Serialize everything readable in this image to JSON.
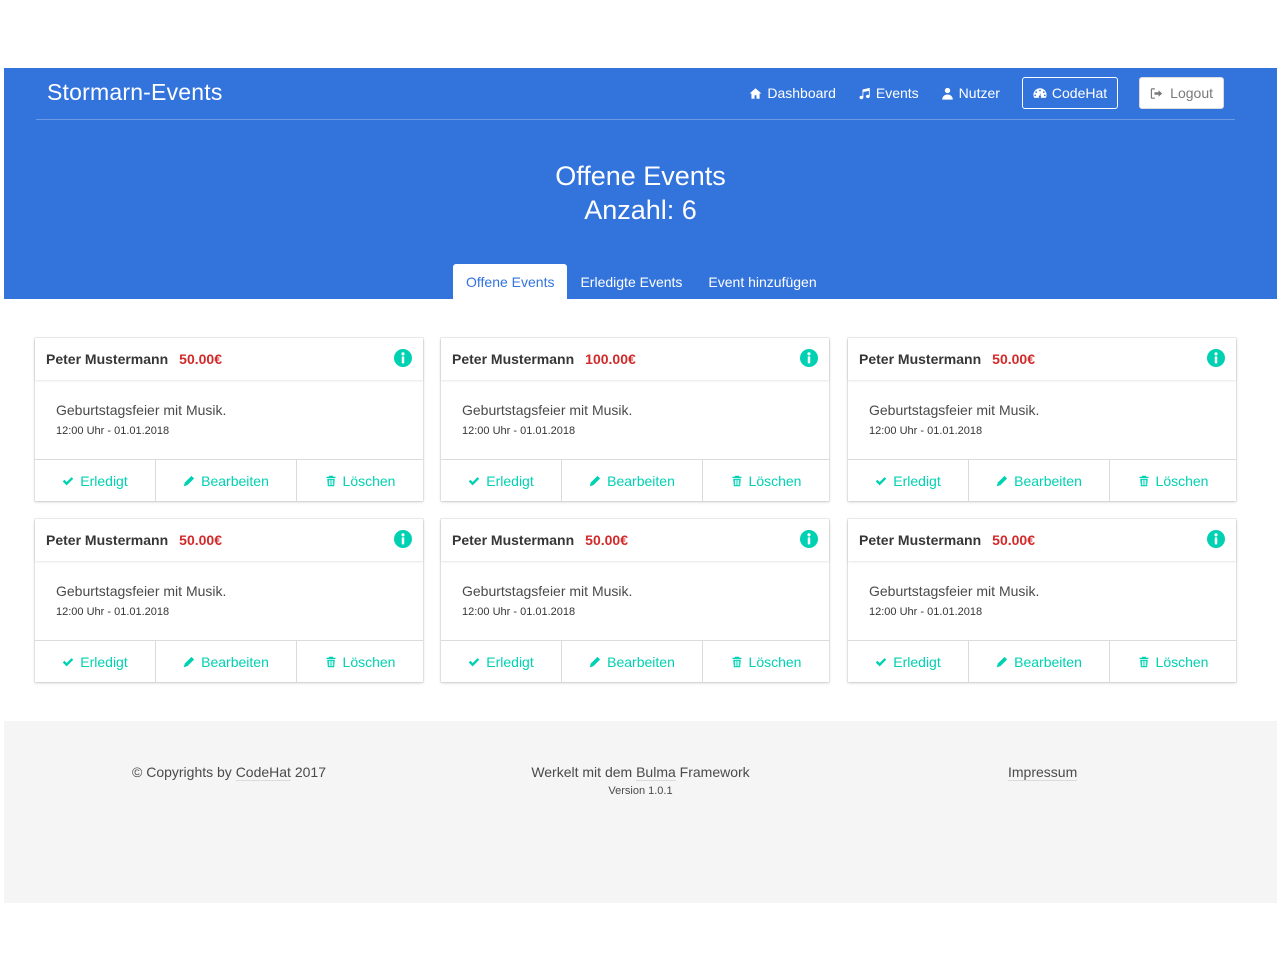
{
  "nav": {
    "brand": "Stormarn-Events",
    "links": [
      {
        "label": "Dashboard",
        "icon": "home-icon"
      },
      {
        "label": "Events",
        "icon": "music-icon"
      },
      {
        "label": "Nutzer",
        "icon": "user-icon"
      }
    ],
    "codehat_label": "CodeHat",
    "logout_label": "Logout"
  },
  "hero": {
    "title": "Offene Events",
    "subtitle": "Anzahl: 6"
  },
  "tabs": [
    {
      "label": "Offene Events",
      "active": true
    },
    {
      "label": "Erledigte Events",
      "active": false
    },
    {
      "label": "Event hinzufügen",
      "active": false
    }
  ],
  "events": [
    {
      "name": "Peter Mustermann",
      "price": "50.00€",
      "description": "Geburtstagsfeier mit Musik.",
      "datetime": "12:00 Uhr - 01.01.2018"
    },
    {
      "name": "Peter Mustermann",
      "price": "100.00€",
      "description": "Geburtstagsfeier mit Musik.",
      "datetime": "12:00 Uhr - 01.01.2018"
    },
    {
      "name": "Peter Mustermann",
      "price": "50.00€",
      "description": "Geburtstagsfeier mit Musik.",
      "datetime": "12:00 Uhr - 01.01.2018"
    },
    {
      "name": "Peter Mustermann",
      "price": "50.00€",
      "description": "Geburtstagsfeier mit Musik.",
      "datetime": "12:00 Uhr - 01.01.2018"
    },
    {
      "name": "Peter Mustermann",
      "price": "50.00€",
      "description": "Geburtstagsfeier mit Musik.",
      "datetime": "12:00 Uhr - 01.01.2018"
    },
    {
      "name": "Peter Mustermann",
      "price": "50.00€",
      "description": "Geburtstagsfeier mit Musik.",
      "datetime": "12:00 Uhr - 01.01.2018"
    }
  ],
  "card_actions": {
    "done": "Erledigt",
    "edit": "Bearbeiten",
    "delete": "Löschen"
  },
  "footer": {
    "copyright_prefix": "© Copyrights by ",
    "copyright_link": "CodeHat",
    "copyright_suffix": " 2017",
    "made_prefix": "Werkelt mit dem ",
    "made_link": "Bulma",
    "made_suffix": " Framework",
    "version": "Version 1.0.1",
    "impressum": "Impressum"
  },
  "colors": {
    "primary": "#3273dc",
    "accent": "#00d1b2",
    "price": "#d12a2a",
    "footer_bg": "#f5f5f5"
  }
}
